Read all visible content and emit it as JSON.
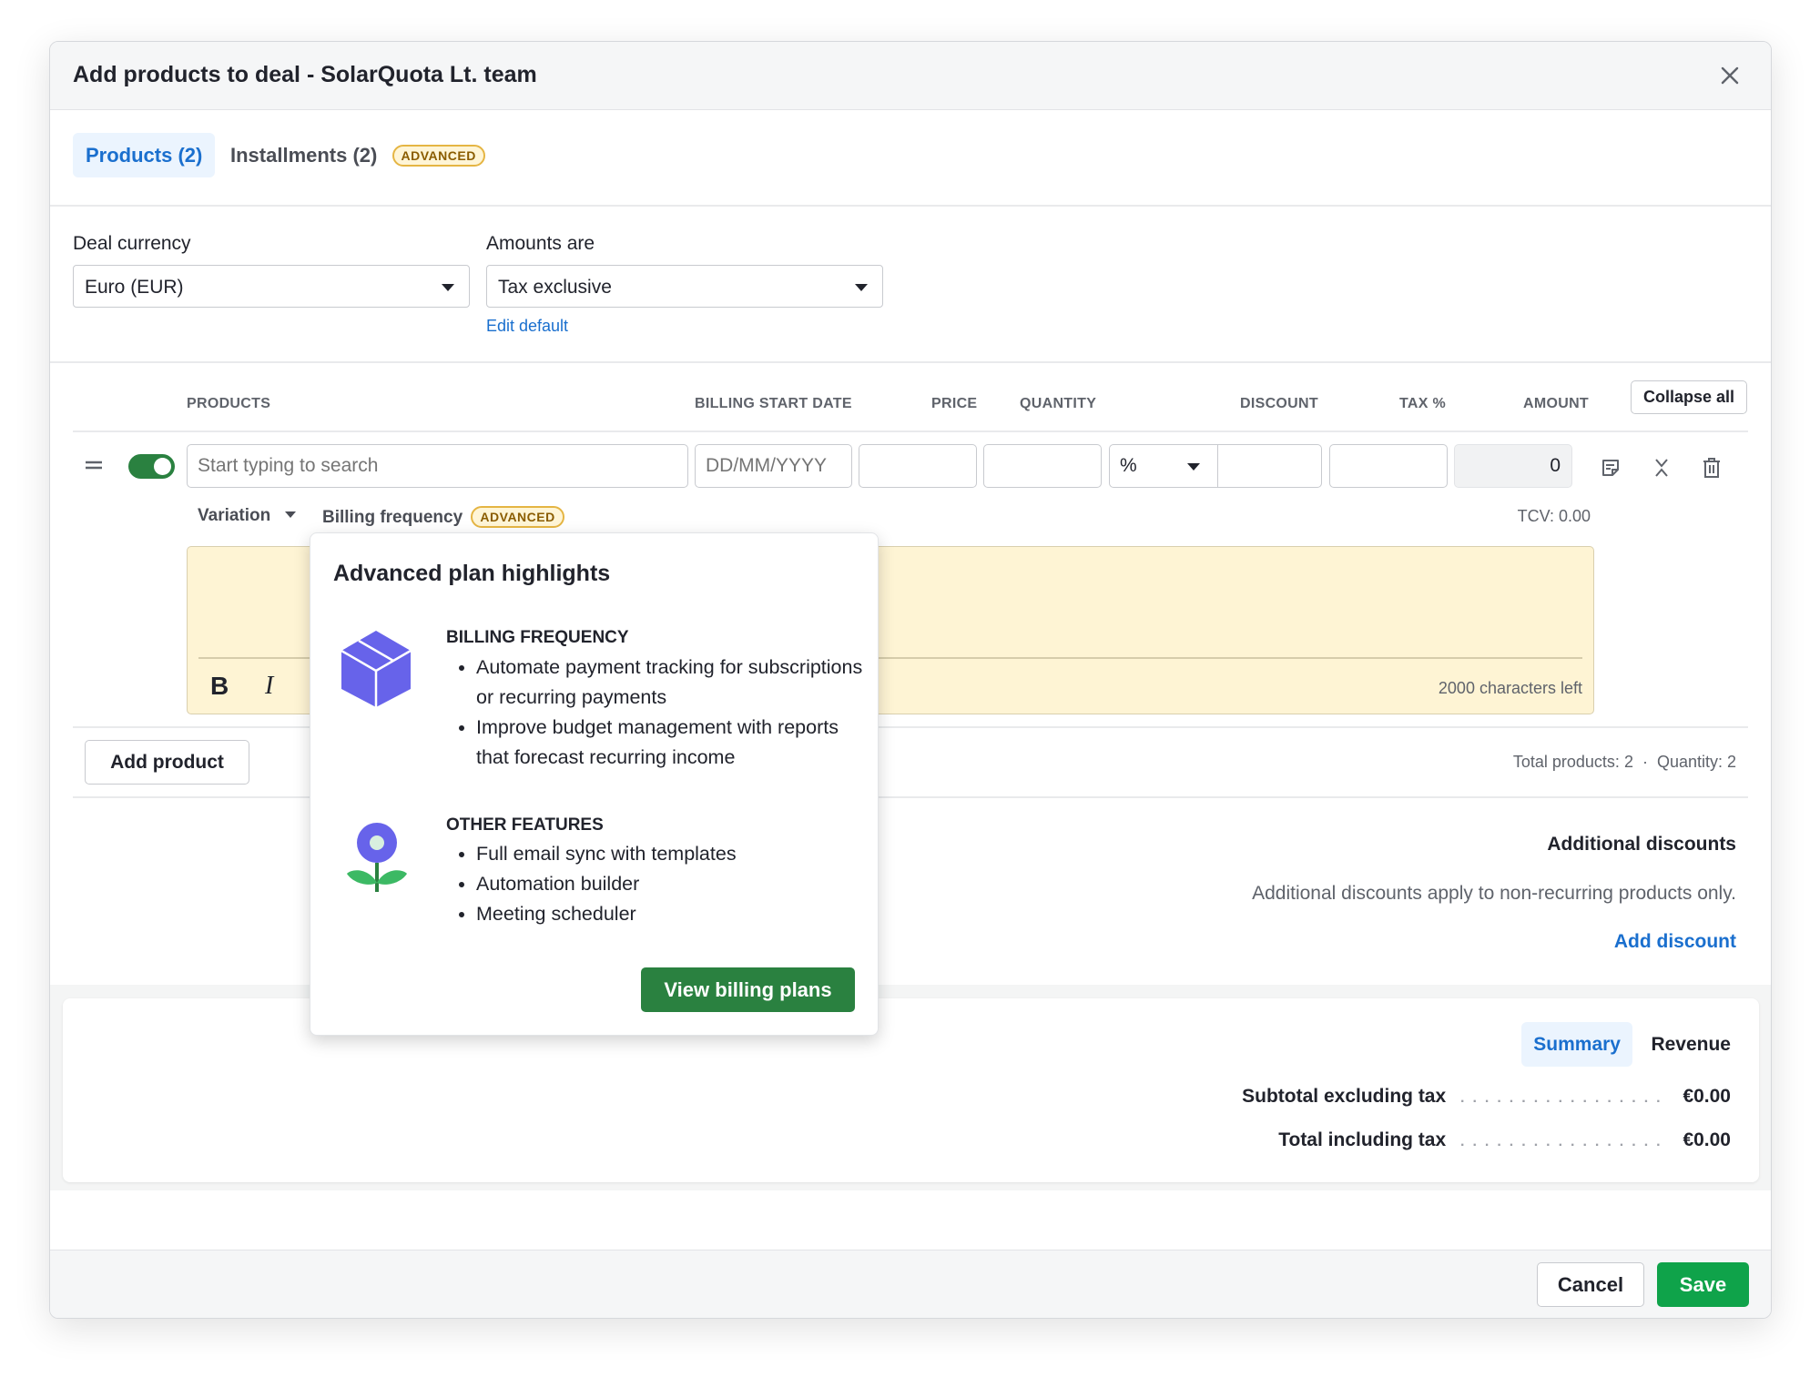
{
  "modal": {
    "title": "Add products to deal - SolarQuota Lt. team",
    "close_icon": "close-icon"
  },
  "tabs": [
    {
      "label": "Products (2)",
      "active": true
    },
    {
      "label": "Installments (2)",
      "active": false,
      "badge": "ADVANCED"
    }
  ],
  "settings": {
    "currency_label": "Deal currency",
    "currency_value": "Euro (EUR)",
    "amounts_label": "Amounts are",
    "amounts_value": "Tax exclusive",
    "edit_default": "Edit default"
  },
  "table": {
    "columns": [
      "PRODUCTS",
      "BILLING START DATE",
      "PRICE",
      "QUANTITY",
      "DISCOUNT",
      "TAX %",
      "AMOUNT"
    ],
    "collapse_all": "Collapse all",
    "row": {
      "enabled": true,
      "product_placeholder": "Start typing to search",
      "date_placeholder": "DD/MM/YYYY",
      "price": "",
      "quantity": "",
      "discount_type": "%",
      "discount": "",
      "tax": "",
      "amount": "0",
      "variation_label": "Variation",
      "billing_frequency_label": "Billing frequency",
      "billing_frequency_badge": "ADVANCED",
      "tcv": "TCV: 0.00",
      "note_chars_left": "2000 characters left",
      "note_bold": "B",
      "note_italic": "I"
    },
    "add_product": "Add product",
    "totals": "Total products: 2  ·  Quantity: 2"
  },
  "discounts": {
    "title": "Additional discounts",
    "description": "Additional discounts apply to non-recurring products only.",
    "add_discount": "Add discount"
  },
  "summary": {
    "tabs": [
      {
        "label": "Summary",
        "active": true
      },
      {
        "label": "Revenue",
        "active": false
      }
    ],
    "rows": [
      {
        "label": "Subtotal excluding tax",
        "value": "€0.00"
      },
      {
        "label": "Total including tax",
        "value": "€0.00"
      }
    ]
  },
  "popover": {
    "title": "Advanced plan highlights",
    "sections": [
      {
        "icon": "box-icon",
        "heading": "BILLING FREQUENCY",
        "items": [
          "Automate payment tracking for subscriptions or recurring payments",
          "Improve budget management with reports that forecast recurring income"
        ]
      },
      {
        "icon": "flower-icon",
        "heading": "OTHER FEATURES",
        "items": [
          "Full email sync with templates",
          "Automation builder",
          "Meeting scheduler"
        ]
      }
    ],
    "cta": "View billing plans"
  },
  "footer": {
    "cancel": "Cancel",
    "save": "Save"
  },
  "colors": {
    "primary_blue": "#1a6fce",
    "save_green": "#0fa34a",
    "cta_green": "#2a8140",
    "toggle_green": "#2a8140",
    "note_yellow": "#fef4d4",
    "badge_border": "#e5b543"
  }
}
